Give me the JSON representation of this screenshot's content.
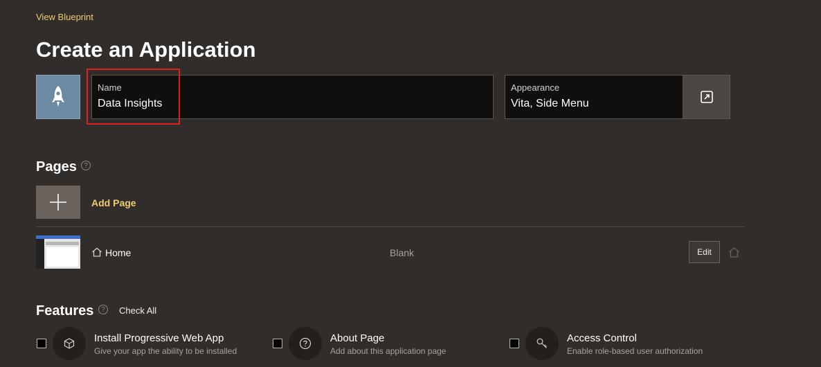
{
  "header": {
    "view_blueprint": "View Blueprint",
    "title": "Create an Application"
  },
  "app_icon": "rocket-icon",
  "name_field": {
    "label": "Name",
    "value": "Data Insights"
  },
  "appearance_field": {
    "label": "Appearance",
    "value": "Vita, Side Menu",
    "button_icon": "external-open-icon"
  },
  "pages": {
    "title": "Pages",
    "add_label": "Add Page",
    "items": [
      {
        "name": "Home",
        "type": "Blank",
        "edit_label": "Edit",
        "home_icon": "home-icon"
      }
    ]
  },
  "features": {
    "title": "Features",
    "check_all": "Check All",
    "items": [
      {
        "title": "Install Progressive Web App",
        "description": "Give your app the ability to be installed",
        "icon": "cube-icon"
      },
      {
        "title": "About Page",
        "description": "Add about this application page",
        "icon": "question-icon"
      },
      {
        "title": "Access Control",
        "description": "Enable role-based user authorization",
        "icon": "key-icon"
      }
    ]
  },
  "colors": {
    "accent": "#f0cc71",
    "background": "#312d2a",
    "highlight": "#e02020"
  }
}
